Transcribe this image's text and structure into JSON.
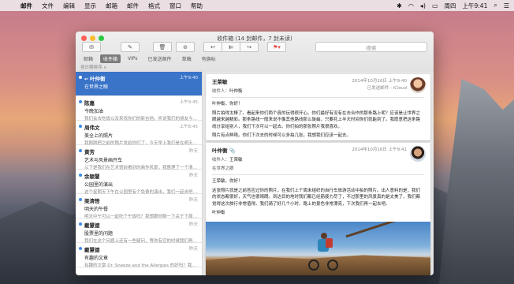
{
  "menubar": {
    "app_name": "邮件",
    "menus": [
      "文件",
      "编辑",
      "显示",
      "邮箱",
      "邮件",
      "格式",
      "窗口",
      "帮助"
    ],
    "clock": "上午9:41",
    "day": "周四"
  },
  "window": {
    "title": "收件箱 (14 封邮件，7 封未读)",
    "search_placeholder": "搜索",
    "favorites": [
      "邮箱",
      "收件箱",
      "VIPs",
      "已发送邮件",
      "草稿",
      "有旗标"
    ],
    "filter_label": "按日期排序 ∨"
  },
  "messages": [
    {
      "sender": "叶仲衡",
      "date": "上午9:40",
      "subject": "在世界之眼",
      "preview": "",
      "selected": true,
      "replied": true
    },
    {
      "sender": "陈嘉",
      "date": "上午9:45",
      "subject": "今晚加油",
      "preview": "我们会去吃饭以及来找你们的新吉他。听说我们的朋友今晚要来。",
      "selected": false,
      "replied": true
    },
    {
      "sender": "周伟文",
      "date": "上午8:45",
      "subject": "美全上的照片",
      "preview": "我刚刚把之前的照片发给你们了，今天早上我们是在明天就在一起了。",
      "selected": false,
      "replied": false
    },
    {
      "sender": "黄芳",
      "date": "昨天",
      "subject": "艺术与风景画开车",
      "preview": "以下是我们在艺术馆前看到的画作风景，我整理了一个清单。",
      "selected": false,
      "replied": false
    },
    {
      "sender": "余颖慧",
      "date": "昨天",
      "subject": "公园里的演出",
      "preview": "这个星期天下午在公园里有个免费的演出，我们一起去吧，天气也不错。",
      "selected": false,
      "replied": false
    },
    {
      "sender": "梁清悟",
      "date": "昨天",
      "subject": "明天的午餐",
      "preview": "明天中午可以一起吃个午饭吗？我想跟你聊一下关于下周的那个项目。",
      "selected": false,
      "replied": false
    },
    {
      "sender": "戴慧德",
      "date": "昨天",
      "subject": "股票里的问题",
      "preview": "我们在这个问题上还有一些疑问，等你有空的时候我们再讨论一下吧。",
      "selected": false,
      "replied": false
    },
    {
      "sender": "戴慧德",
      "date": "昨天",
      "subject": "有趣的文章",
      "preview": "有趣的文章 Dr. Sneeze and the Allergies 的好吗？我想要你看看。",
      "selected": false,
      "replied": false
    }
  ],
  "reading": {
    "msg1": {
      "from": "王荣敏",
      "to_label": "收件人：",
      "to": "叶仲衡",
      "date": "2014年10月16日 上午9:40",
      "account": "已发送邮件 - iCloud",
      "greeting": "叶仲衡，你好！",
      "body": "照片拍得太棒了。看起来你们两个真的玩得很开心。你们最好有没有在去合作的那条路上呢？应该是让世界之眼越来越精彩。那条路线一般来说不像其他路线那么陡峭，只要花上半天时间你们就能到了。我愿意把这条路线分享给别人，我们下次可以一起去。你们拍的那张照片我很喜欢。",
      "sign": "照片有点鲜艳。你们下次去的时候可以多拍几张。我想我们应该一起去。"
    },
    "msg2": {
      "from": "叶仲衡",
      "to_label": "收件人：",
      "to": "王荣敏",
      "date": "2014年10月16日 上午9:41",
      "subject": "在世界之眼",
      "greeting": "王荣敏，你好！",
      "body": "这张照片就是之前答应过你的照片，在我们上个周末组织的自行车旅游活动中拍的照片。出人意料的是，我们的状态都很好，天气也很晴朗。到达目的地时我们都已经筋疲力尽了，不过那里的风景真的是太美了，我们都觉得这次旅行非常值得。我们骑了好几个小时，路上的景色非常漂亮，下次我们再一起去吧。",
      "sign": "叶仲衡"
    }
  },
  "colors": {
    "selection": "#3a74c9",
    "unread_dot": "#3d8be8",
    "flag": "#e8463a"
  }
}
